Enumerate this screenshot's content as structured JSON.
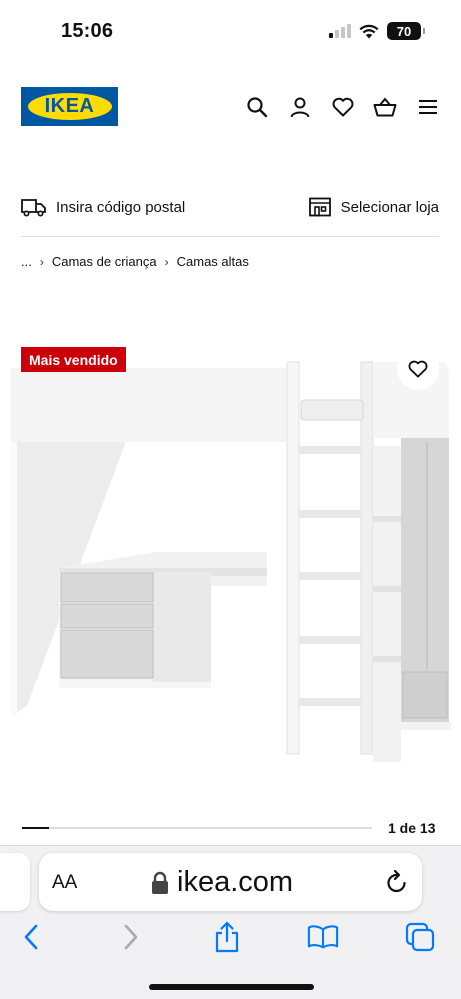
{
  "status_bar": {
    "time": "15:06",
    "battery": "70",
    "signal_bars_active": 1
  },
  "header": {
    "logo_text": "IKEA",
    "icons": [
      "search-icon",
      "user-icon",
      "heart-icon",
      "basket-icon",
      "menu-icon"
    ]
  },
  "delivery": {
    "postal_label": "Insira código postal",
    "store_label": "Selecionar loja"
  },
  "breadcrumb": {
    "ellipsis": "...",
    "items": [
      "Camas de criança",
      "Camas altas"
    ]
  },
  "product": {
    "badge": "Mais vendido"
  },
  "carousel": {
    "counter": "1 de 13",
    "progress": 0.077
  },
  "safari": {
    "text_size_label": "AA",
    "url": "ikea.com"
  },
  "colors": {
    "ikea_blue": "#0058a3",
    "ikea_yellow": "#ffdb00",
    "badge_red": "#cc0008",
    "ios_blue": "#007aff"
  }
}
